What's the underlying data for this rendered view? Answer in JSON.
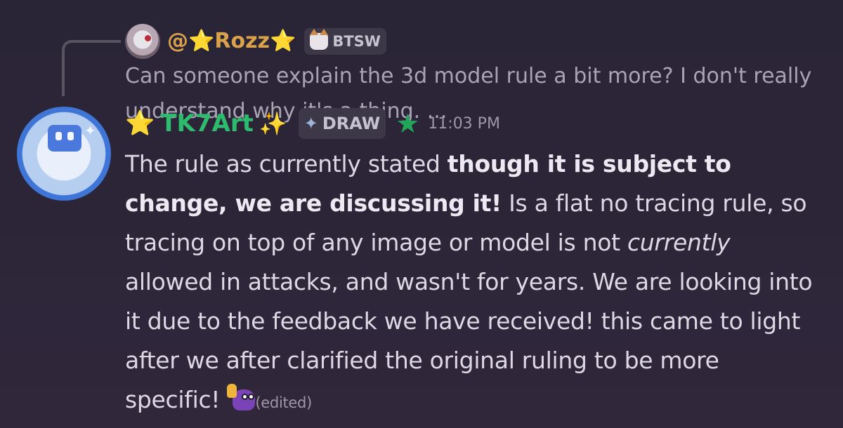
{
  "reply": {
    "author": "@⭐Rozz⭐",
    "role_tag": "BTSW",
    "preview_text": "Can someone explain the 3d model rule a bit more? I don't really understand why it's a thing. ..."
  },
  "message": {
    "author": "TK7Art",
    "leading_emoji": "⭐",
    "trailing_emoji": "✨",
    "role_tag": "DRAW",
    "role_icon": "✦",
    "timestamp": "11:03 PM",
    "body": {
      "p1": "The rule as currently stated ",
      "bold1": "though it is subject to change, we are discussing it!",
      "p2": " Is a flat no tracing rule, so tracing on top of any image or model is not ",
      "italic1": "currently",
      "p3": " allowed in attacks, and wasn't for years. We are looking into it due to the feedback we have received! this came to light after we after clarified the original ruling to be more specific! "
    },
    "edited_label": "(edited)"
  },
  "icons": {
    "reply_avatar": "user-avatar",
    "author_avatar": "robot-avatar",
    "reply_tag_icon": "cat-icon",
    "draw_tag_icon": "sword-icon",
    "role_star_icon": "green-star-icon",
    "reaction_emoji": "thumbs-up-blob-emoji"
  },
  "colors": {
    "author_name": "#2dbb6e",
    "reply_name": "#d9a14a",
    "background": "#2c2538",
    "role_star": "#23a55a"
  }
}
